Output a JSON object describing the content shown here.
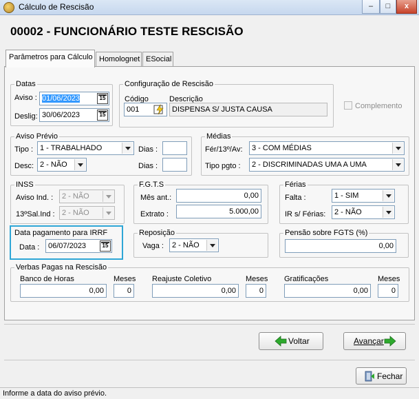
{
  "window": {
    "title": "Cálculo de Rescisão",
    "minimize": "–",
    "maximize": "□",
    "close": "x"
  },
  "header": {
    "title": "00002 - FUNCIONÁRIO TESTE RESCISÃO"
  },
  "tabs": [
    {
      "label": "Parâmetros para Cálculo",
      "active": true
    },
    {
      "label": "Homolognet",
      "active": false
    },
    {
      "label": "ESocial",
      "active": false
    }
  ],
  "datas": {
    "legend": "Datas",
    "aviso_label": "Aviso :",
    "aviso_value": "01/06/2023",
    "deslig_label": "Deslig:",
    "deslig_value": "30/06/2023",
    "calendar_glyph": "15"
  },
  "config": {
    "legend": "Configuração de Rescisão",
    "codigo_label": "Código",
    "codigo_value": "001",
    "descricao_label": "Descrição",
    "descricao_value": "DISPENSA S/ JUSTA CAUSA"
  },
  "complemento": {
    "label": "Complemento",
    "checked": false
  },
  "aviso_previo": {
    "legend": "Aviso Prévio",
    "tipo_label": "Tipo :",
    "tipo_value": "1 - TRABALHADO",
    "desc_label": "Desc:",
    "desc_value": "2 - NÃO",
    "dias_label": "Dias :",
    "dias1_value": "",
    "dias2_value": ""
  },
  "medias": {
    "legend": "Médias",
    "fer_label": "Fér/13º/Av:",
    "fer_value": "3 - COM MÉDIAS",
    "tipo_label": "Tipo pgto :",
    "tipo_value": "2 - DISCRIMINADAS UMA A UMA"
  },
  "inss": {
    "legend": "INSS",
    "aviso_label": "Aviso Ind. :",
    "aviso_value": "2 - NÃO",
    "sal_label": "13ºSal.Ind :",
    "sal_value": "2 - NÃO"
  },
  "fgts": {
    "legend": "F.G.T.S",
    "mes_label": "Mês ant.:",
    "mes_value": "0,00",
    "extrato_label": "Extrato :",
    "extrato_value": "5.000,00"
  },
  "ferias": {
    "legend": "Férias",
    "falta_label": "Falta :",
    "falta_value": "1 - SIM",
    "ir_label": "IR s/ Férias:",
    "ir_value": "2 - NÃO"
  },
  "irrf": {
    "legend": "Data pagamento para IRRF",
    "data_label": "Data :",
    "data_value": "06/07/2023"
  },
  "reposicao": {
    "legend": "Reposição",
    "vaga_label": "Vaga :",
    "vaga_value": "2 - NÃO"
  },
  "pensao": {
    "legend": "Pensão sobre FGTS (%)",
    "value": "0,00"
  },
  "verbas": {
    "legend": "Verbas Pagas na Rescisão",
    "items": [
      {
        "label": "Banco de Horas",
        "meses_label": "Meses",
        "value": "0,00",
        "meses": "0"
      },
      {
        "label": "Reajuste Coletivo",
        "meses_label": "Meses",
        "value": "0,00",
        "meses": "0"
      },
      {
        "label": "Gratificações",
        "meses_label": "Meses",
        "value": "0,00",
        "meses": "0"
      }
    ]
  },
  "buttons": {
    "voltar": "Voltar",
    "avancar": "Avançar",
    "fechar": "Fechar"
  },
  "status": {
    "text": "Informe a data do aviso prévio."
  },
  "colors": {
    "highlight": "#2ea6d6",
    "arrow_green": "#2eaa2e",
    "selection": "#3399ff"
  }
}
